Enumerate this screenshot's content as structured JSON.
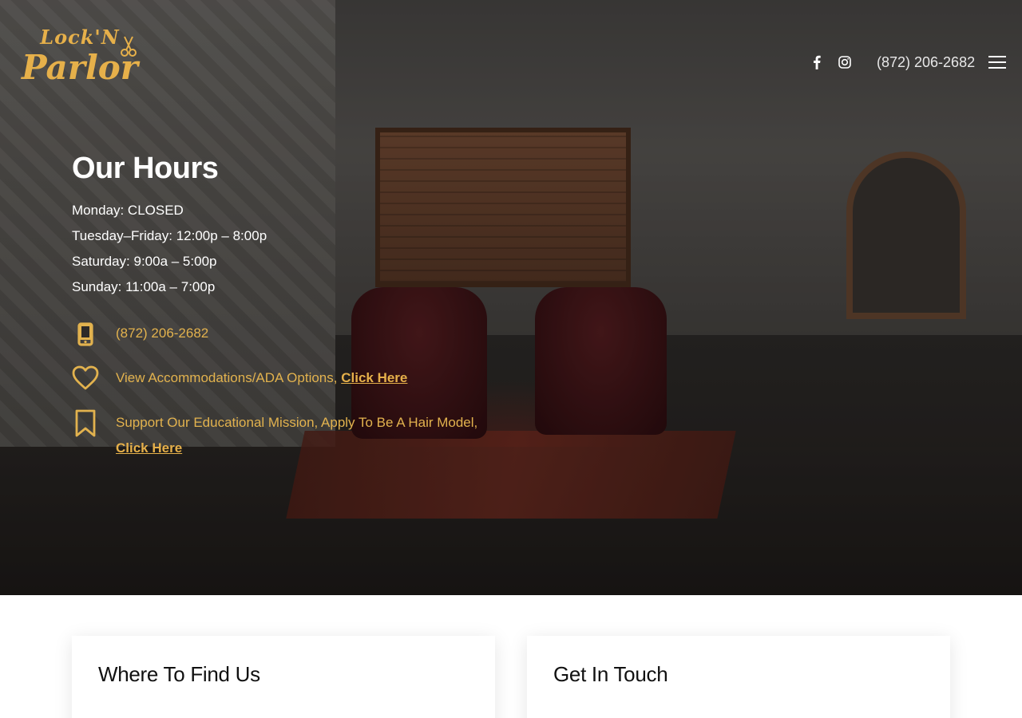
{
  "header": {
    "logo_line1": "Lock'N",
    "logo_line2": "Parlor",
    "phone": "(872) 206-2682",
    "social": [
      "facebook-icon",
      "instagram-icon"
    ],
    "menu_icon": "hamburger-menu-icon"
  },
  "hours": {
    "title": "Our Hours",
    "lines": [
      "Monday: CLOSED",
      "Tuesday–Friday: 12:00p – 8:00p",
      "Saturday: 9:00a –  5:00p",
      "Sunday: 11:00a – 7:00p"
    ]
  },
  "info": {
    "phone": {
      "icon": "mobile-phone-icon",
      "text": "(872) 206-2682"
    },
    "accommodations": {
      "icon": "heart-icon",
      "text": "View Accommodations/ADA Options, ",
      "link": "Click Here"
    },
    "hair_model": {
      "icon": "bookmark-icon",
      "text": "Support Our Educational Mission, Apply To Be A Hair Model,",
      "link": "Click Here"
    }
  },
  "cards": {
    "left_title": "Where To Find Us",
    "right_title": "Get In Touch"
  },
  "colors": {
    "accent": "#e2b24e",
    "text_light": "#ffffff"
  }
}
